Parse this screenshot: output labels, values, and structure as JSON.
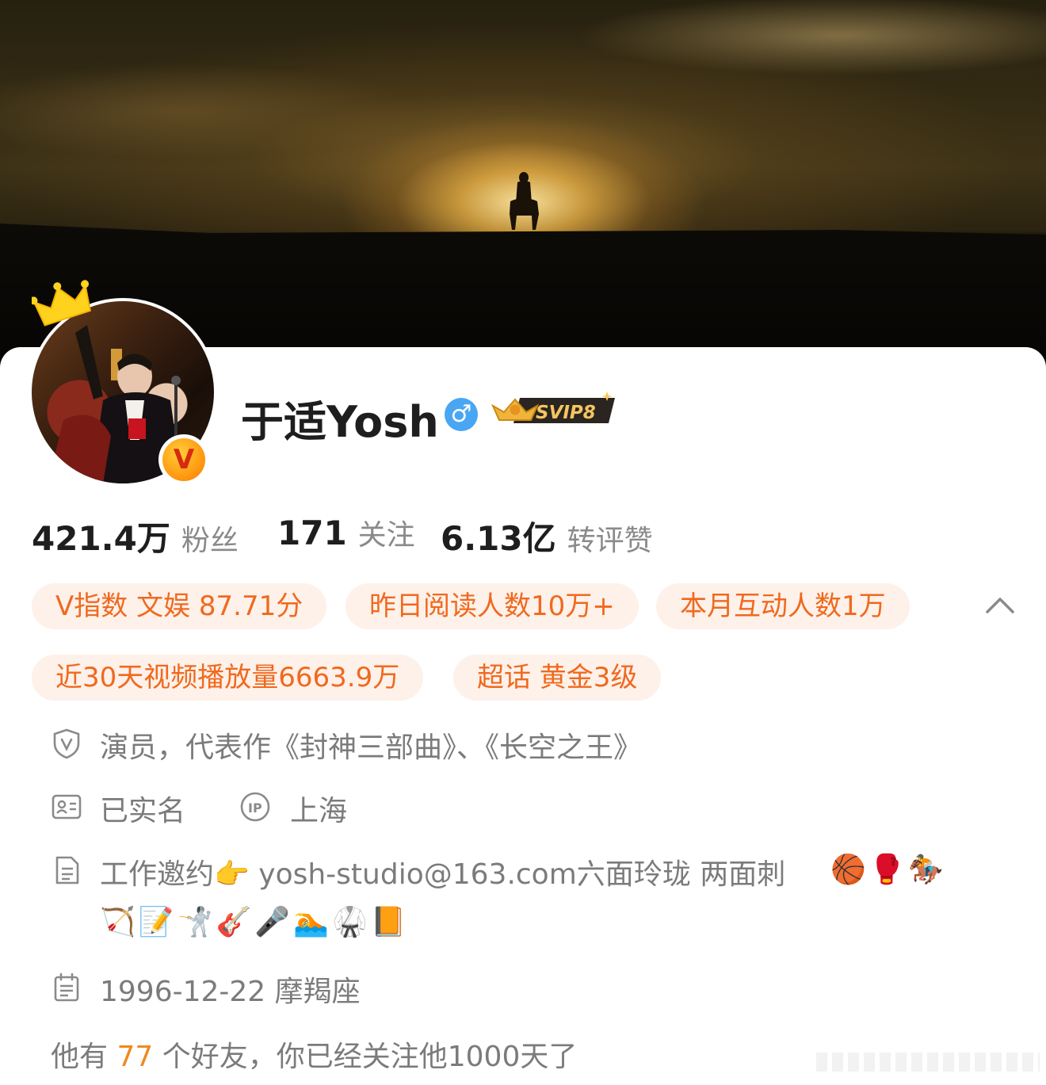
{
  "profile": {
    "name": "于适Yosh",
    "gender_symbol": "♂",
    "vip_badge": "SVIP8",
    "verified_letter": "V"
  },
  "stats": [
    {
      "value": "421.4万",
      "label": "粉丝"
    },
    {
      "value": "171",
      "label": "关注"
    },
    {
      "value": "6.13亿",
      "label": "转评赞"
    }
  ],
  "chips": [
    "V指数 文娱 87.71分",
    "昨日阅读人数10万+",
    "本月互动人数1万",
    "近30天视频播放量6663.9万",
    "超话 黄金3级"
  ],
  "info": {
    "verification": "演员，代表作《封神三部曲》、《长空之王》",
    "realname": "已实名",
    "ip_location": "上海",
    "bio_line1": "工作邀约👉 yosh-studio@163.com六面玲珑 两面刺",
    "bio_emojis_1": "🏀🥊🏇",
    "bio_emojis_2": "🏹📝🤺🎸🎤🏊🥋📙",
    "birthday": "1996-12-22 摩羯座"
  },
  "friends": {
    "prefix": "他有",
    "count": "77",
    "suffix": "个好友，你已经关注他1000天了"
  },
  "colors": {
    "accent": "#f0691f",
    "chip_bg": "#fdf1e9",
    "gender_blue": "#49a6f2",
    "text_gray": "#7b7b7b"
  },
  "icons": [
    "shield-v-icon",
    "id-card-icon",
    "ip-icon",
    "document-icon",
    "calendar-icon",
    "chevron-up-icon",
    "crown-icon"
  ]
}
